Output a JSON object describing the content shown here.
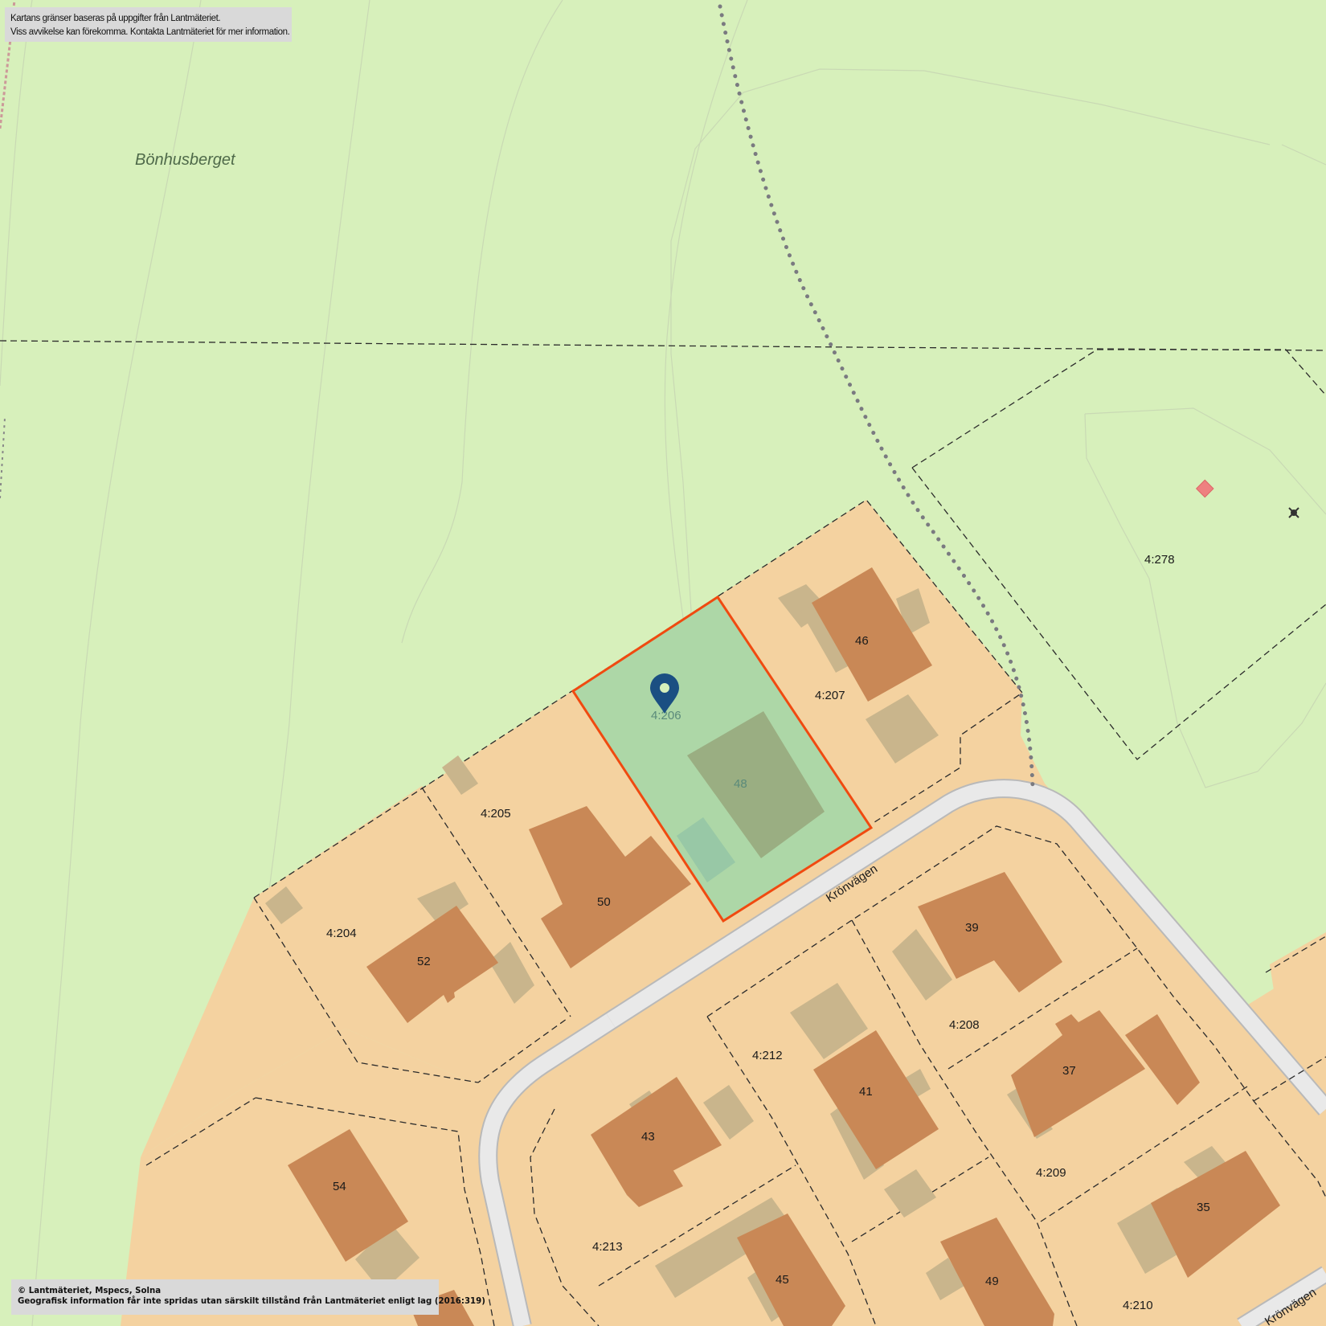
{
  "place_name": "Bönhusberget",
  "notice_top": {
    "line1": "Kartans gränser baseras på uppgifter från Lantmäteriet.",
    "line2": "Viss avvikelse kan förekomma. Kontakta Lantmäteriet för mer information."
  },
  "notice_bottom": {
    "line1": "© Lantmäteriet, Mspecs, Solna",
    "line2": "Geografisk information får inte spridas utan särskilt tillstånd från Lantmäteriet enligt lag (2016:319)"
  },
  "street_name": "Krönvägen",
  "selected_parcel": {
    "id": "4:206",
    "house_number": "48"
  },
  "parcels": {
    "p204": "4:204",
    "p205": "4:205",
    "p207": "4:207",
    "p208": "4:208",
    "p209": "4:209",
    "p210": "4:210",
    "p212": "4:212",
    "p213": "4:213",
    "p278": "4:278"
  },
  "house_numbers": {
    "h35": "35",
    "h37": "37",
    "h39": "39",
    "h41": "41",
    "h43": "43",
    "h45": "45",
    "h46": "46",
    "h49": "49",
    "h50": "50",
    "h52": "52",
    "h54": "54"
  },
  "icons": {
    "pin": "location-pin-icon",
    "point_marker": "red-square-marker-icon",
    "cross_marker": "survey-point-icon"
  },
  "colors": {
    "forest": "#d7f0bb",
    "plot": "#f4d2a0",
    "house": "#c98856",
    "outbuilding": "#c9b58c",
    "selected_fill": "#a9d7a8",
    "selected_border": "#f04a10",
    "pin": "#1b4f82",
    "road": "#e9e9e9"
  }
}
